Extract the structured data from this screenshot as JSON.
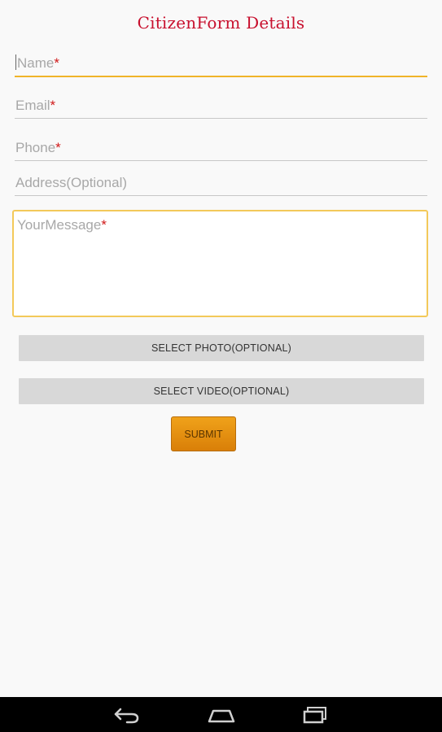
{
  "header": {
    "title": "CitizenForm Details"
  },
  "form": {
    "name": {
      "placeholder": "Name",
      "required_mark": "*"
    },
    "email": {
      "placeholder": "Email",
      "required_mark": "*"
    },
    "phone": {
      "placeholder": "Phone",
      "required_mark": "*"
    },
    "address": {
      "placeholder": "Address(Optional)"
    },
    "message": {
      "placeholder": "YourMessage",
      "required_mark": "*"
    }
  },
  "buttons": {
    "select_photo": "SELECT PHOTO(OPTIONAL)",
    "select_video": "SELECT VIDEO(OPTIONAL)",
    "submit": "SUBMIT"
  },
  "colors": {
    "title": "#c8102e",
    "required": "#d01919",
    "focus_underline": "#f0b429",
    "submit_button": "#e8931a"
  },
  "navbar": {
    "icons": [
      "back-icon",
      "home-icon",
      "recent-apps-icon"
    ]
  }
}
